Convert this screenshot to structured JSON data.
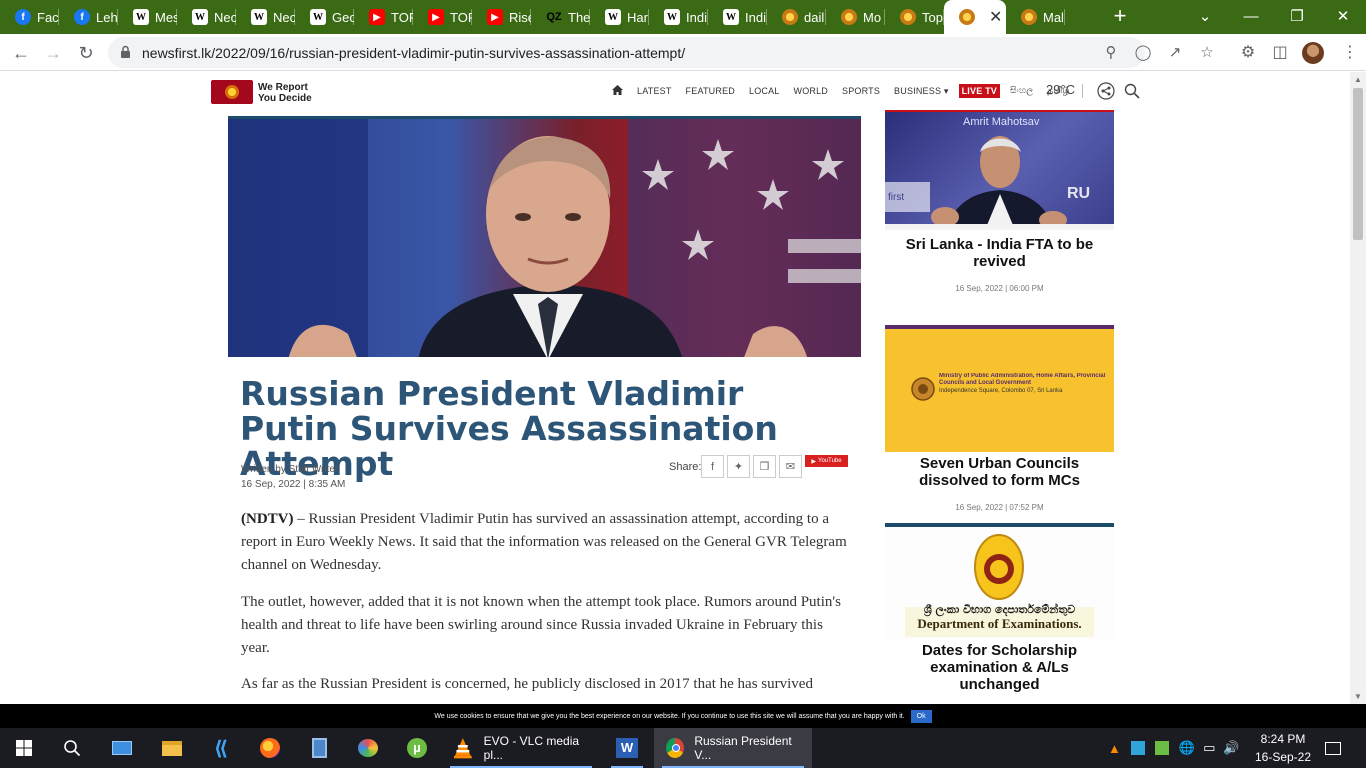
{
  "browser": {
    "tabs": [
      {
        "label": "Face",
        "icon": "facebook-icon",
        "color": "#1877f2",
        "glyph": "f"
      },
      {
        "label": "Leh",
        "icon": "facebook-icon",
        "color": "#1877f2",
        "glyph": "f"
      },
      {
        "label": "Mes",
        "icon": "wikipedia-icon",
        "color": "#ffffff",
        "glyph": "W"
      },
      {
        "label": "Neo",
        "icon": "wikipedia-icon",
        "color": "#ffffff",
        "glyph": "W"
      },
      {
        "label": "Neo",
        "icon": "wikipedia-icon",
        "color": "#ffffff",
        "glyph": "W"
      },
      {
        "label": "Geo",
        "icon": "wikipedia-icon",
        "color": "#ffffff",
        "glyph": "W"
      },
      {
        "label": "TOF",
        "icon": "youtube-icon",
        "color": "#ff0000",
        "glyph": "▶"
      },
      {
        "label": "TOF",
        "icon": "youtube-icon",
        "color": "#ff0000",
        "glyph": "▶"
      },
      {
        "label": "Rise",
        "icon": "youtube-icon",
        "color": "#ff0000",
        "glyph": "▶"
      },
      {
        "label": "The",
        "icon": "quartz-icon",
        "color": "#000000",
        "glyph": "QZ"
      },
      {
        "label": "Har",
        "icon": "wikipedia-icon",
        "color": "#ffffff",
        "glyph": "W"
      },
      {
        "label": "Indi",
        "icon": "wikipedia-icon",
        "color": "#ffffff",
        "glyph": "W"
      },
      {
        "label": "Indi",
        "icon": "wikipedia-icon",
        "color": "#ffffff",
        "glyph": "W"
      },
      {
        "label": "dail",
        "icon": "newsfirst-icon",
        "color": "#d9a020",
        "glyph": ""
      },
      {
        "label": "Mo",
        "icon": "newsfirst-icon",
        "color": "#d9a020",
        "glyph": ""
      },
      {
        "label": "Top",
        "icon": "newsfirst-icon",
        "color": "#d9a020",
        "glyph": ""
      },
      {
        "label": "",
        "icon": "newsfirst-icon",
        "color": "#d9a020",
        "glyph": "",
        "active": true
      },
      {
        "label": "Mal",
        "icon": "newsfirst-icon",
        "color": "#d9a020",
        "glyph": ""
      }
    ],
    "url": "newsfirst.lk/2022/09/16/russian-president-vladimir-putin-survives-assassination-attempt/"
  },
  "site": {
    "tagline_line1": "We Report",
    "tagline_line2": "You Decide",
    "nav": [
      "LATEST",
      "FEATURED",
      "LOCAL",
      "WORLD",
      "SPORTS",
      "BUSINESS ▾"
    ],
    "live_tv": "LIVE TV",
    "lang_sinhala": "සිංහල",
    "lang_tamil": "தமிழ்",
    "temperature": "29°C"
  },
  "article": {
    "headline": "Russian President Vladimir Putin Survives Assassination Attempt",
    "author": "Written by Staff Writer",
    "date": "16 Sep, 2022 | 8:35 AM",
    "share_label": "Share:",
    "youtube_label": "YouTube",
    "source": "(NDTV)",
    "p1": " – Russian President Vladimir Putin has survived an assassination attempt, according to a report in Euro Weekly News. It said that the information was released on the General GVR Telegram channel on Wednesday.",
    "p2": "The outlet, however, added that it is not known when the attempt took place. Rumors around Putin's health and threat to life have been swirling around since Russia invaded Ukraine in February this year.",
    "p3": "As far as the Russian President is concerned, he publicly disclosed in 2017 that he has survived"
  },
  "sidebar": [
    {
      "title": "Sri Lanka - India FTA to be revived",
      "date": "16 Sep, 2022 | 06:00 PM",
      "img_text": "Amrit Mahotsav",
      "accent": "#c8101a"
    },
    {
      "title": "Seven Urban Councils dissolved to form MCs",
      "date": "16 Sep, 2022 | 07:52 PM",
      "img_text": "Ministry of Public Administration, Home Affairs, Provincial Councils and Local Government",
      "img_sub": "Independence Square, Colombo 07, Sri Lanka",
      "accent": "#5a2b6b"
    },
    {
      "title": "Dates for Scholarship examination & A/Ls unchanged",
      "date": "",
      "img_text_si": "ශ්‍රී ලංකා විභාග දෙපාර්තමේන්තුව",
      "img_text_en": "Department of Examinations.",
      "accent": "#1d4d6b"
    }
  ],
  "cookie": {
    "text": "We use cookies to ensure that we give you the best experience on our website. If you continue to use this site we will assume that you are happy with it.",
    "ok": "Ok"
  },
  "taskbar": {
    "vlc_label": "EVO - VLC media pl...",
    "chrome_label": "Russian President V...",
    "time": "8:24 PM",
    "date": "16-Sep-22"
  }
}
